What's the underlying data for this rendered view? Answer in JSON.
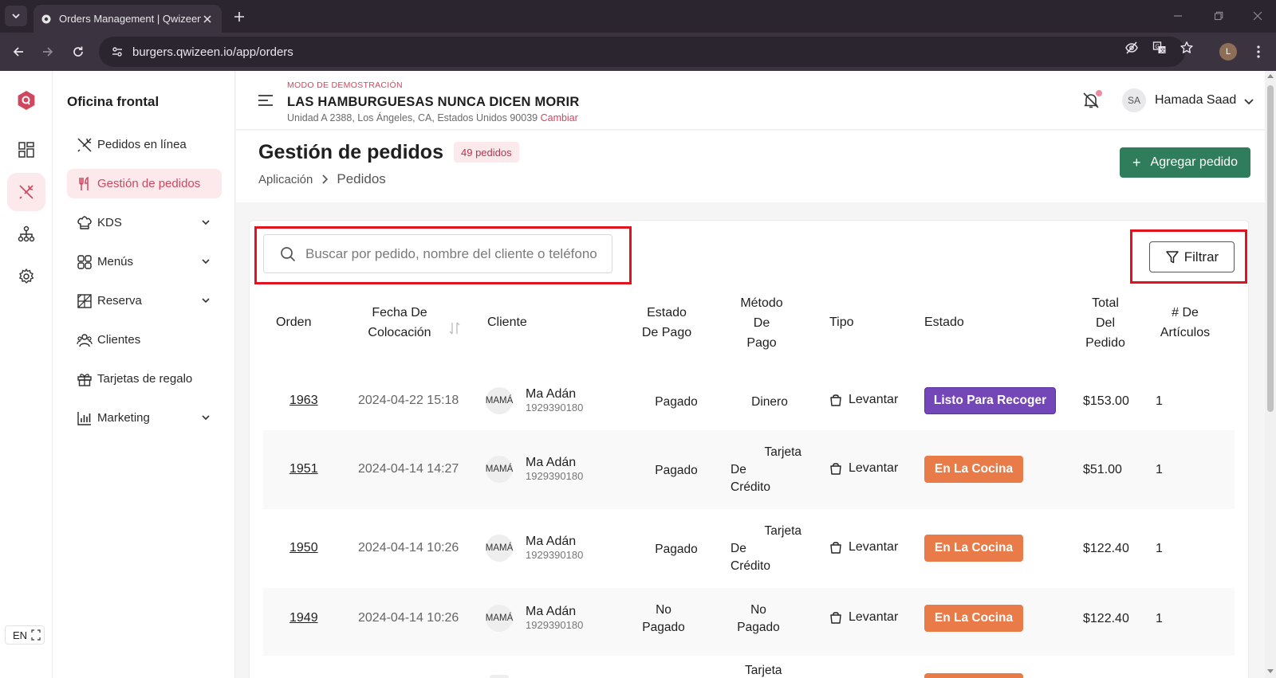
{
  "browser": {
    "tab_title": "Orders Management | Qwizeen",
    "url": "burgers.qwizeen.io/app/orders"
  },
  "sidebar": {
    "title": "Oficina frontal",
    "items": [
      {
        "label": "Pedidos en línea",
        "icon": "utensils-crossed-icon",
        "expandable": false,
        "active": false
      },
      {
        "label": "Gestión de pedidos",
        "icon": "fork-knife-icon",
        "expandable": false,
        "active": true
      },
      {
        "label": "KDS",
        "icon": "chef-hat-icon",
        "expandable": true,
        "active": false
      },
      {
        "label": "Menús",
        "icon": "grid-icon",
        "expandable": true,
        "active": false
      },
      {
        "label": "Reserva",
        "icon": "reservation-icon",
        "expandable": true,
        "active": false
      },
      {
        "label": "Clientes",
        "icon": "users-icon",
        "expandable": false,
        "active": false
      },
      {
        "label": "Tarjetas de regalo",
        "icon": "gift-icon",
        "expandable": false,
        "active": false
      },
      {
        "label": "Marketing",
        "icon": "bar-chart-icon",
        "expandable": true,
        "active": false
      }
    ]
  },
  "rail": {
    "lang": "EN"
  },
  "header": {
    "demo_label": "MODO DE DEMOSTRACIÓN",
    "restaurant_name": "LAS HAMBURGUESAS NUNCA DICEN MORIR",
    "address": "Unidad A 2388, Los Ángeles, CA, Estados Unidos 90039",
    "change_label": "Cambiar",
    "user_initials": "SA",
    "user_name": "Hamada Saad"
  },
  "page": {
    "title": "Gestión de pedidos",
    "count_badge": "49 pedidos",
    "breadcrumb_root": "Aplicación",
    "breadcrumb_current": "Pedidos",
    "add_button": "Agregar pedido",
    "add_button_icon": "+"
  },
  "toolbar": {
    "search_placeholder": "Buscar por pedido, nombre del cliente o teléfono",
    "filter_label": "Filtrar"
  },
  "table": {
    "headers": {
      "order": "Orden",
      "date_l1": "Fecha De",
      "date_l2": "Colocación",
      "customer": "Cliente",
      "paystatus_l1": "Estado",
      "paystatus_l2": "De Pago",
      "paymethod_l1": "Método",
      "paymethod_l2": "De",
      "paymethod_l3": "Pago",
      "type": "Tipo",
      "status": "Estado",
      "total_l1": "Total",
      "total_l2": "Del",
      "total_l3": "Pedido",
      "items_l1": "# De",
      "items_l2": "Artículos"
    },
    "rows": [
      {
        "order": "1963",
        "date": "2024-04-22 15:18",
        "avatar": "MAMÁ",
        "name": "Ma Adán",
        "phone": "1929390180",
        "pay_status_l1": "Pagado",
        "pay_status_l2": "",
        "pay_method_l1": "Dinero",
        "pay_method_l2": "",
        "pay_method_l3": "",
        "type": "Levantar",
        "status": "Listo Para Recoger",
        "total": "$153.00",
        "items": "1"
      },
      {
        "order": "1951",
        "date": "2024-04-14 14:27",
        "avatar": "MAMÁ",
        "name": "Ma Adán",
        "phone": "1929390180",
        "pay_status_l1": "Pagado",
        "pay_status_l2": "",
        "pay_method_l1": "Tarjeta",
        "pay_method_l2": "De",
        "pay_method_l3": "Crédito",
        "type": "Levantar",
        "status": "En La Cocina",
        "total": "$51.00",
        "items": "1"
      },
      {
        "order": "1950",
        "date": "2024-04-14 10:26",
        "avatar": "MAMÁ",
        "name": "Ma Adán",
        "phone": "1929390180",
        "pay_status_l1": "Pagado",
        "pay_status_l2": "",
        "pay_method_l1": "Tarjeta",
        "pay_method_l2": "De",
        "pay_method_l3": "Crédito",
        "type": "Levantar",
        "status": "En La Cocina",
        "total": "$122.40",
        "items": "1"
      },
      {
        "order": "1949",
        "date": "2024-04-14 10:26",
        "avatar": "MAMÁ",
        "name": "Ma Adán",
        "phone": "1929390180",
        "pay_status_l1": "No",
        "pay_status_l2": "Pagado",
        "pay_method_l1": "No",
        "pay_method_l2": "Pagado",
        "pay_method_l3": "",
        "type": "Levantar",
        "status": "En La Cocina",
        "total": "$122.40",
        "items": "1"
      },
      {
        "pay_method_l1": "Tarjeta"
      }
    ]
  },
  "colors": {
    "brand_pink": "#d0485f",
    "add_green": "#2f7d5b",
    "status_purple": "#7447b8",
    "status_orange": "#e87b48",
    "highlight_red": "#e0131f"
  }
}
